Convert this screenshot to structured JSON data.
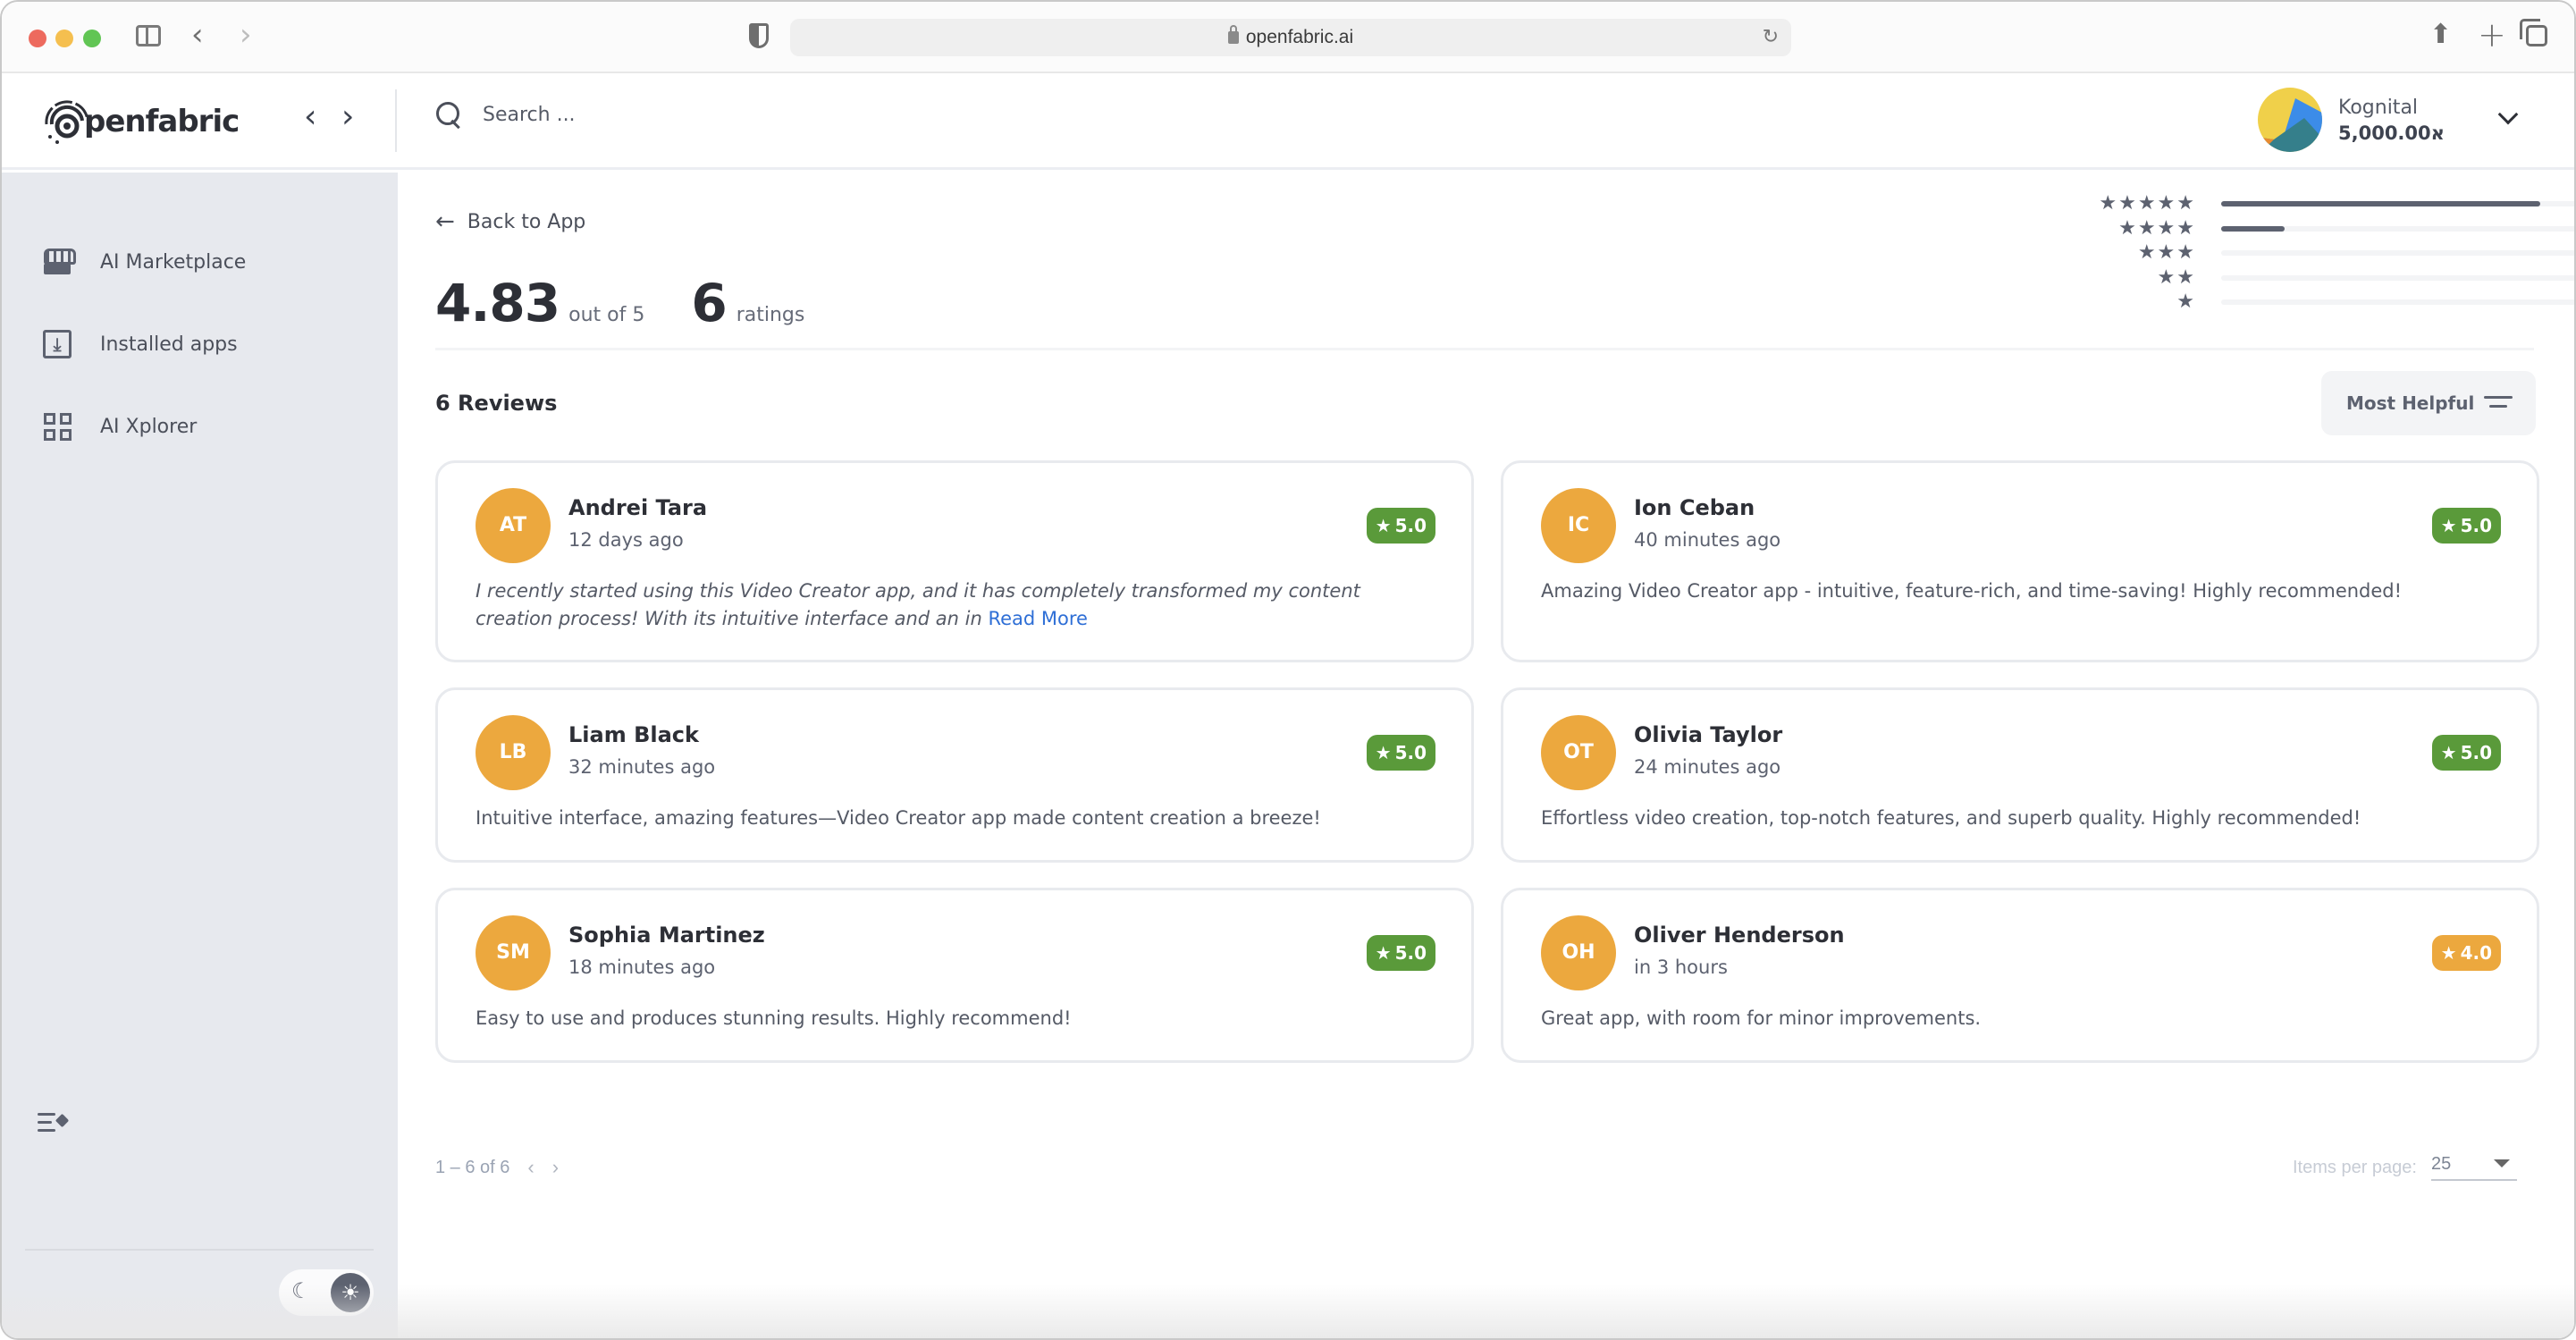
{
  "browser": {
    "url": "openfabric.ai"
  },
  "header": {
    "logo_text": "penfabric",
    "search_placeholder": "Search ...",
    "user": {
      "name": "Kognital",
      "balance": "5,000.00א"
    }
  },
  "sidebar": {
    "items": [
      {
        "label": "AI Marketplace",
        "icon": "storefront-icon"
      },
      {
        "label": "Installed apps",
        "icon": "download-box-icon"
      },
      {
        "label": "AI Xplorer",
        "icon": "grid-icon"
      }
    ],
    "theme": "light"
  },
  "summary": {
    "back_label": "Back to App",
    "average": "4.83",
    "out_of": "out of 5",
    "ratings_count": "6",
    "ratings_label": "ratings",
    "distribution": [
      {
        "stars": 5,
        "stars_text": "★★★★★",
        "count": 5,
        "fraction": 0.833
      },
      {
        "stars": 4,
        "stars_text": "★★★★",
        "count": 1,
        "fraction": 0.167
      },
      {
        "stars": 3,
        "stars_text": "★★★",
        "count": 0,
        "fraction": 0
      },
      {
        "stars": 2,
        "stars_text": "★★",
        "count": 0,
        "fraction": 0
      },
      {
        "stars": 1,
        "stars_text": "★",
        "count": 0,
        "fraction": 0
      }
    ]
  },
  "reviews": {
    "title": "6 Reviews",
    "sort_label": "Most Helpful",
    "items": [
      {
        "initials": "AT",
        "name": "Andrei Tara",
        "time": "12 days ago",
        "rating": "5.0",
        "badge_color": "#5a9a3a",
        "text": "I recently started using this Video Creator app, and it has completely transformed my content creation process! With its intuitive interface and an in ",
        "read_more": "Read More",
        "italic": true
      },
      {
        "initials": "IC",
        "name": "Ion Ceban",
        "time": "40 minutes ago",
        "rating": "5.0",
        "badge_color": "#5a9a3a",
        "text": "Amazing Video Creator app - intuitive, feature-rich, and time-saving! Highly recommended!"
      },
      {
        "initials": "LB",
        "name": "Liam Black",
        "time": "32 minutes ago",
        "rating": "5.0",
        "badge_color": "#5a9a3a",
        "text": "Intuitive interface, amazing features—Video Creator app made content creation a breeze!"
      },
      {
        "initials": "OT",
        "name": "Olivia Taylor",
        "time": "24 minutes ago",
        "rating": "5.0",
        "badge_color": "#5a9a3a",
        "text": "Effortless video creation, top-notch features, and superb quality. Highly recommended!"
      },
      {
        "initials": "SM",
        "name": "Sophia Martinez",
        "time": "18 minutes ago",
        "rating": "5.0",
        "badge_color": "#5a9a3a",
        "text": "Easy to use and produces stunning results. Highly recommend!"
      },
      {
        "initials": "OH",
        "name": "Oliver Henderson",
        "time": "in 3 hours",
        "rating": "4.0",
        "badge_color": "#eca83e",
        "text": "Great app, with room for minor improvements."
      }
    ]
  },
  "pagination": {
    "range": "1 – 6 of 6",
    "items_per_page_label": "Items per page:",
    "items_per_page": "25"
  },
  "colors": {
    "avatar": "#eca83e",
    "badge_good": "#5a9a3a",
    "badge_ok": "#eca83e",
    "link": "#2f6fd6",
    "text_dark": "#2d2f36"
  }
}
